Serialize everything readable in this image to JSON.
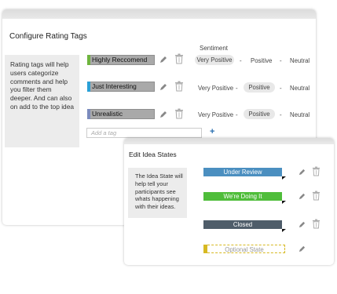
{
  "rating_tags": {
    "title": "Configure Rating Tags",
    "description": "Rating tags will help users categorize comments and help you filter them deeper. And can also on add to the top idea",
    "sentiment_header": "Sentiment",
    "tags": [
      {
        "label": "Highly Reccomend",
        "color": "#6fb43f",
        "sentiment": {
          "very_positive": "Very Positive",
          "positive": "Positive",
          "neutral": "Neutral",
          "separator": "-",
          "selected": "very_positive"
        }
      },
      {
        "label": "Just Interesting",
        "color": "#2aa0d6",
        "sentiment": {
          "very_positive": "Very Positive",
          "positive": "Positive",
          "neutral": "Neutral",
          "separator": "-",
          "selected": "positive"
        }
      },
      {
        "label": "Unrealistic",
        "color": "#7b8bbd",
        "sentiment": {
          "very_positive": "Very Positive",
          "positive": "Positive",
          "neutral": "Neutral",
          "separator": "-",
          "selected": "positive"
        }
      }
    ],
    "add_tag_placeholder": "Add a tag",
    "add_button": "+"
  },
  "idea_states": {
    "title": "Edit Idea States",
    "description": "The Idea State will help tell your participants see whats happening with their ideas.",
    "states": [
      {
        "label": "Under Review",
        "color": "#4b8fc0",
        "text_color": "#ffffff"
      },
      {
        "label": "We're Doing It",
        "color": "#4fbd3a",
        "text_color": "#ffffff"
      },
      {
        "label": "Closed",
        "color": "#4f5d6a",
        "text_color": "#ffffff"
      },
      {
        "label": "Optional State",
        "color": "#ffffff",
        "text_color": "#999999",
        "accent": "#d7b922"
      }
    ]
  },
  "icons": {
    "edit": "pencil-icon",
    "delete": "trash-icon"
  }
}
